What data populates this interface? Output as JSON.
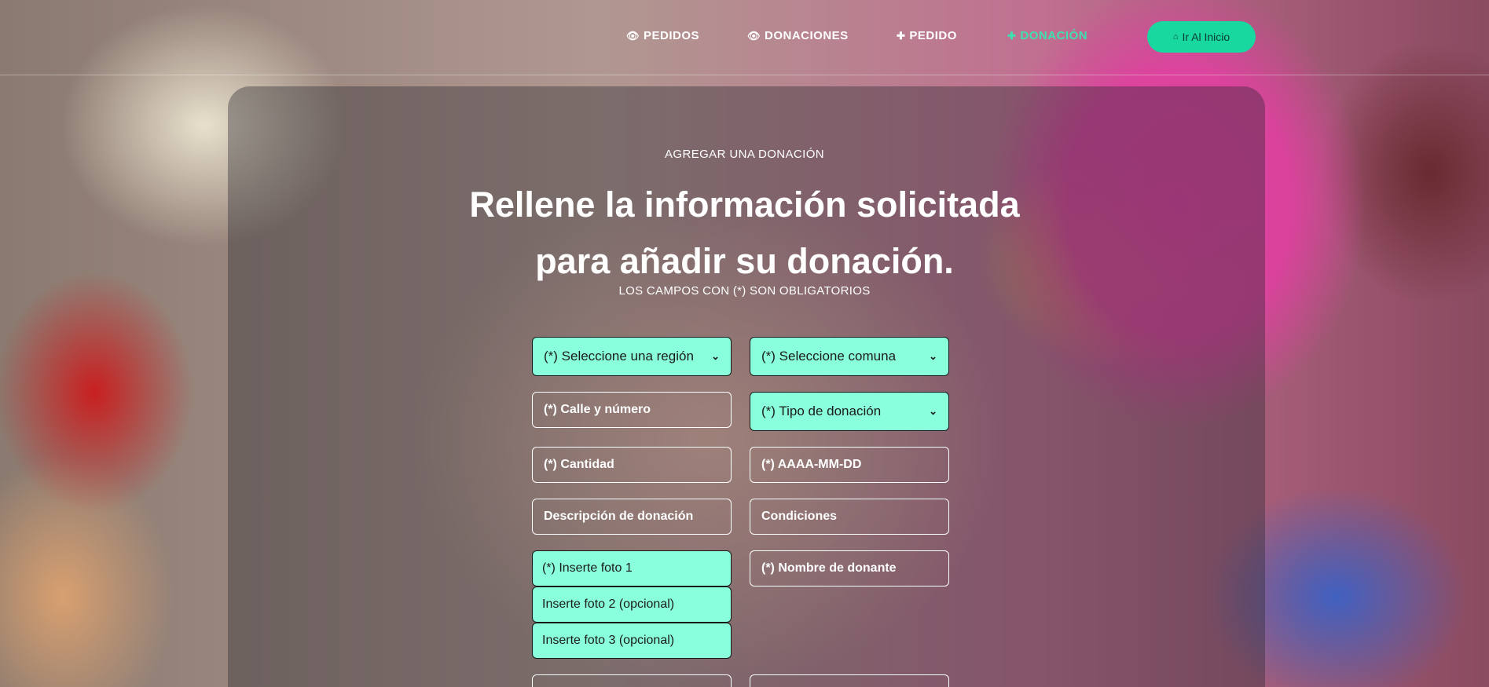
{
  "nav": {
    "items": [
      {
        "label": "PEDIDOS",
        "icon": "eye-icon",
        "glyph": "👁",
        "active": false
      },
      {
        "label": "DONACIONES",
        "icon": "eye-icon",
        "glyph": "👁",
        "active": false
      },
      {
        "label": "PEDIDO",
        "icon": "plus-icon",
        "glyph": "✚",
        "active": false
      },
      {
        "label": "DONACIÓN",
        "icon": "plus-icon",
        "glyph": "✚",
        "active": true
      }
    ],
    "home_button": {
      "label": "Ir Al Inicio",
      "icon": "home-icon",
      "glyph": "⌂"
    }
  },
  "header": {
    "eyebrow": "AGREGAR UNA DONACIÓN",
    "title_line1": "Rellene la información solicitada",
    "title_line2": "para añadir su donación.",
    "subtitle": "LOS CAMPOS CON (*) SON OBLIGATORIOS"
  },
  "form": {
    "region_select": "(*) Seleccione una región",
    "comuna_select": "(*) Seleccione comuna",
    "calle_placeholder": "(*) Calle y número",
    "tipo_select": "(*) Tipo de donación",
    "cantidad_placeholder": "(*) Cantidad",
    "fecha_placeholder": "(*) AAAA-MM-DD",
    "descripcion_placeholder": "Descripción de donación",
    "condiciones_placeholder": "Condiciones",
    "foto1": "(*) Inserte foto 1",
    "nombre_placeholder": "(*) Nombre de donante",
    "foto2": "Inserte foto 2 (opcional)",
    "foto3": "Inserte foto 3 (opcional)",
    "chevron": "⌄"
  },
  "colors": {
    "accent": "#18d8a0",
    "active_nav": "#3ee0b0",
    "field_fill": "#8affdc"
  }
}
